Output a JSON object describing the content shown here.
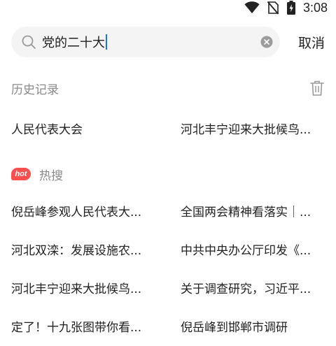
{
  "status_bar": {
    "time": "3:08",
    "icons": [
      "wifi-icon",
      "no-sim-icon",
      "battery-charging-icon"
    ]
  },
  "search": {
    "query": "党的二十大",
    "cancel_label": "取消"
  },
  "history": {
    "title": "历史记录",
    "items": [
      "人民代表大会",
      "河北丰宁迎来大批候鸟..."
    ]
  },
  "hot": {
    "badge": "hot",
    "title": "热搜",
    "items": [
      "倪岳峰参观人民代表大...",
      "全国两会精神看落实｜...",
      "河北双滦：发展设施农...",
      "中共中央办公厅印发《...",
      "河北丰宁迎来大批候鸟...",
      "关于调查研究，习近平...",
      "定了！十九张图带你看...",
      "倪岳峰到邯郸市调研"
    ]
  },
  "colors": {
    "accent_hot": "#ff4e4e",
    "caret": "#1a73e8",
    "search_bg": "#f4f4f5",
    "muted_text": "#8a8a8a"
  }
}
